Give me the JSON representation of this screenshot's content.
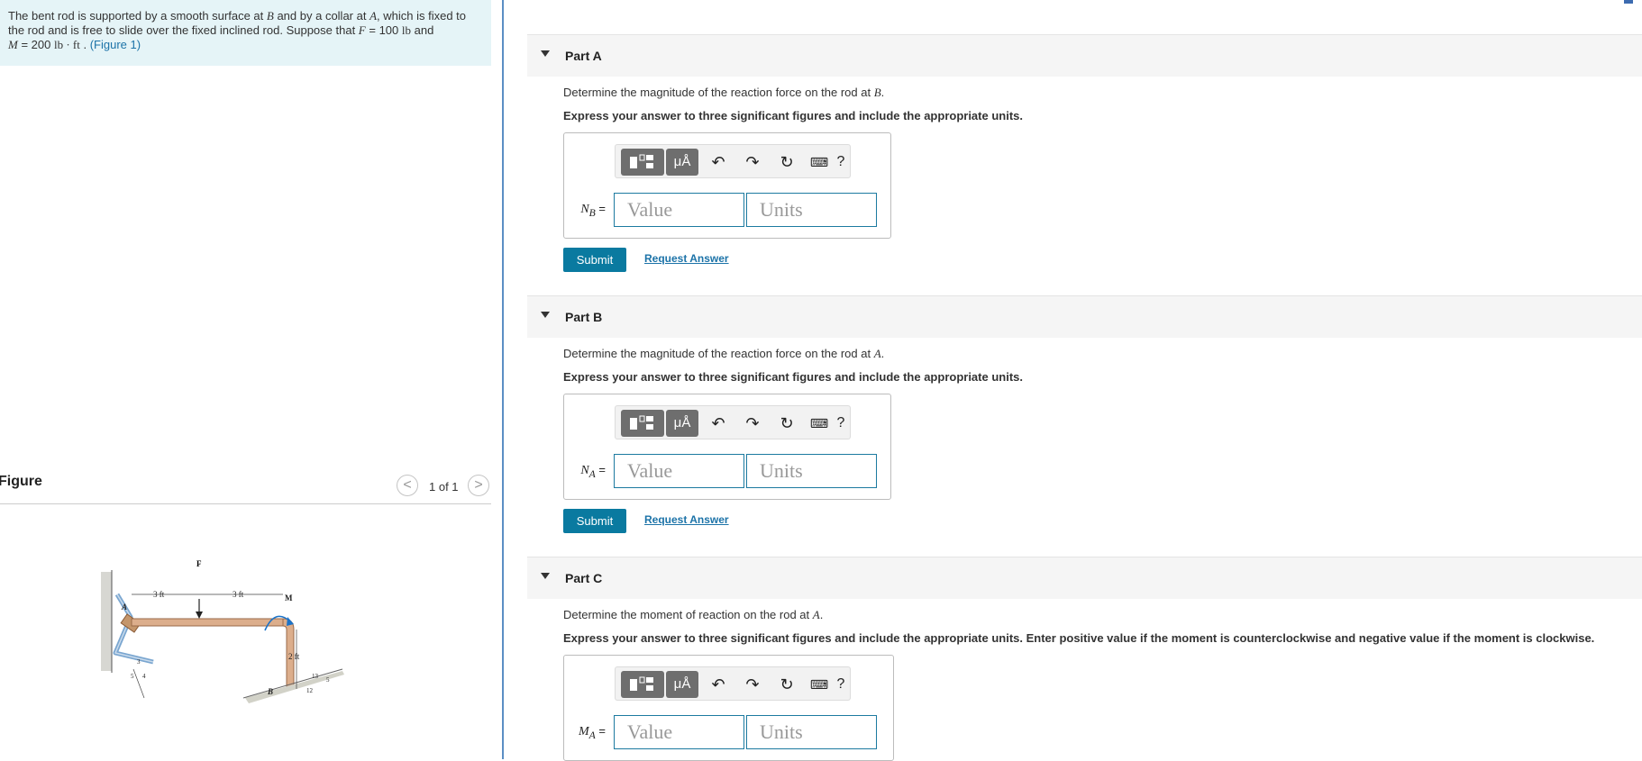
{
  "problem": {
    "text_1": "The bent rod is supported by a smooth surface at ",
    "B": "B",
    "text_2": " and by a collar at ",
    "A": "A",
    "text_3": ", which is fixed to the rod and is free to slide over the fixed inclined rod. Suppose that ",
    "F": "F",
    "text_4": " = 100 ",
    "F_unit": "lb",
    "text_5": " and",
    "M": "M",
    "text_6": " = 200 ",
    "M_unit": "lb · ft",
    "text_7": " . ",
    "figure_link": "(Figure 1)"
  },
  "figure": {
    "title": "Figure",
    "prev": "<",
    "next": ">",
    "counter": "1 of 1",
    "labels": {
      "F": "F",
      "A": "A",
      "B": "B",
      "M": "M",
      "d1": "3 ft",
      "d2": "3 ft",
      "d3": "2 ft",
      "s3": "3",
      "s5": "5",
      "s4": "4",
      "t13": "13",
      "t12": "12",
      "t5": "5"
    }
  },
  "toolbar": {
    "units_symbol": "μÅ",
    "undo": "↶",
    "redo": "↷",
    "reset": "↻",
    "keyboard": "⌨",
    "help": "?"
  },
  "parts": [
    {
      "title": "Part A",
      "question_text": "Determine the magnitude of the reaction force on the rod at ",
      "question_var": "B",
      "instruction": "Express your answer to three significant figures and include the appropriate units.",
      "var_main": "N",
      "var_sub": "B",
      "value_placeholder": "Value",
      "units_placeholder": "Units",
      "submit": "Submit",
      "request": "Request Answer"
    },
    {
      "title": "Part B",
      "question_text": "Determine the magnitude of the reaction force on the rod at ",
      "question_var": "A",
      "instruction": "Express your answer to three significant figures and include the appropriate units.",
      "var_main": "N",
      "var_sub": "A",
      "value_placeholder": "Value",
      "units_placeholder": "Units",
      "submit": "Submit",
      "request": "Request Answer"
    },
    {
      "title": "Part C",
      "question_text": "Determine the moment of reaction on the rod at ",
      "question_var": "A",
      "instruction": "Express your answer to three significant figures and include the appropriate units. Enter positive value if the moment is counterclockwise and negative value if the moment is clockwise.",
      "var_main": "M",
      "var_sub": "A",
      "value_placeholder": "Value",
      "units_placeholder": "Units"
    }
  ],
  "colors": {
    "accent": "#0a7aa0",
    "link": "#1c73a8",
    "problem_bg": "#e5f4f7"
  }
}
